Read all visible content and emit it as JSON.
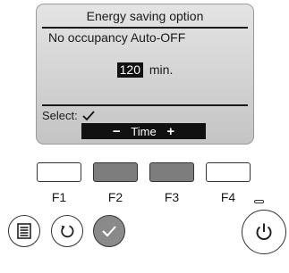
{
  "screen": {
    "title": "Energy saving option",
    "subtitle": "No occupancy Auto-OFF",
    "value": "120",
    "unit": "min.",
    "select_label": "Select:",
    "function_bar": {
      "minus": "−",
      "label": "Time",
      "plus": "+"
    }
  },
  "function_keys": [
    {
      "label": "F1",
      "color": "#ffffff"
    },
    {
      "label": "F2",
      "color": "#7d7d7d"
    },
    {
      "label": "F3",
      "color": "#7d7d7d"
    },
    {
      "label": "F4",
      "color": "#ffffff"
    }
  ],
  "buttons": {
    "menu": {
      "icon": "menu-icon"
    },
    "return": {
      "icon": "return-icon"
    },
    "select": {
      "icon": "check-icon",
      "color": "#8a8a8a"
    },
    "power": {
      "icon": "power-icon"
    }
  }
}
